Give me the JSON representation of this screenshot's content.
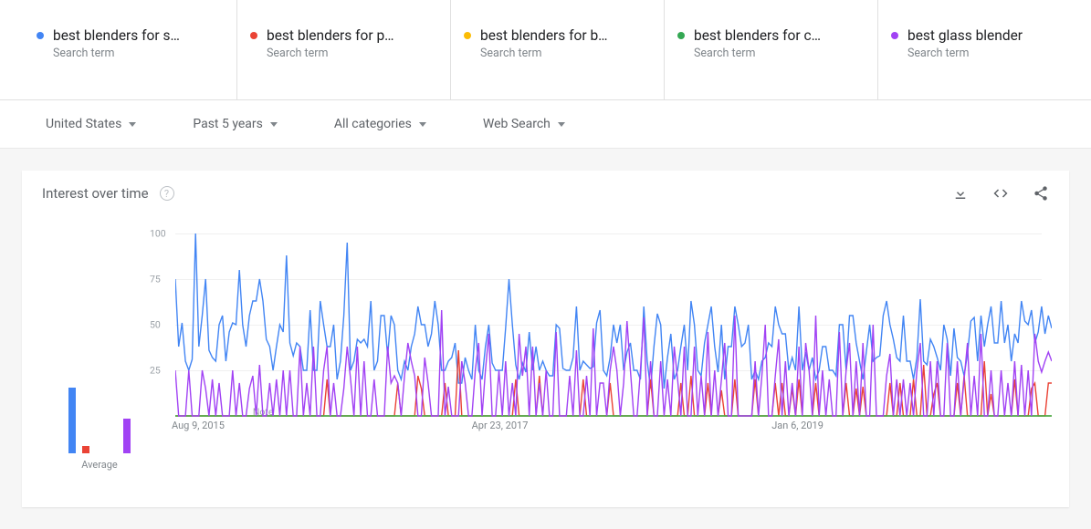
{
  "terms": [
    {
      "label": "best blenders for s…",
      "sub": "Search term",
      "color": "#4285F4"
    },
    {
      "label": "best blenders for p…",
      "sub": "Search term",
      "color": "#EA4335"
    },
    {
      "label": "best blenders for b…",
      "sub": "Search term",
      "color": "#FBBC04"
    },
    {
      "label": "best blenders for c…",
      "sub": "Search term",
      "color": "#34A853"
    },
    {
      "label": "best glass blender",
      "sub": "Search term",
      "color": "#A142F4"
    }
  ],
  "filters": {
    "region": "United States",
    "timeframe": "Past 5 years",
    "category": "All categories",
    "search_type": "Web Search"
  },
  "card": {
    "title": "Interest over time"
  },
  "chart_data": {
    "type": "line",
    "ylim": [
      0,
      100
    ],
    "yticks": [
      25,
      50,
      75,
      100
    ],
    "xticks": [
      {
        "index": 0,
        "label": "Aug 9, 2015"
      },
      {
        "index": 89,
        "label": "Apr 23, 2017"
      },
      {
        "index": 178,
        "label": "Jan 6, 2019"
      }
    ],
    "note": {
      "label": "Note",
      "index": 23
    },
    "averages": [
      38,
      4,
      0,
      0,
      20
    ],
    "avg_label": "Average",
    "n_points": 261,
    "series": [
      {
        "name": "best blenders for s…",
        "color": "#4285F4",
        "values": [
          75,
          38,
          51,
          30,
          25,
          31,
          100,
          38,
          55,
          75,
          36,
          32,
          30,
          50,
          55,
          30,
          46,
          51,
          50,
          80,
          50,
          38,
          55,
          63,
          63,
          75,
          63,
          42,
          38,
          25,
          38,
          50,
          46,
          88,
          40,
          33,
          40,
          38,
          25,
          25,
          58,
          25,
          25,
          63,
          50,
          38,
          38,
          50,
          20,
          30,
          55,
          95,
          25,
          30,
          42,
          40,
          42,
          38,
          63,
          25,
          30,
          55,
          55,
          33,
          55,
          50,
          25,
          20,
          30,
          25,
          38,
          45,
          60,
          50,
          50,
          38,
          45,
          63,
          50,
          25,
          25,
          30,
          32,
          40,
          18,
          18,
          32,
          25,
          20,
          50,
          25,
          20,
          38,
          50,
          29,
          25,
          25,
          25,
          48,
          75,
          50,
          28,
          20,
          29,
          24,
          46,
          25,
          38,
          25,
          30,
          25,
          22,
          22,
          50,
          48,
          26,
          25,
          25,
          32,
          60,
          25,
          30,
          28,
          26,
          27,
          51,
          58,
          25,
          22,
          32,
          50,
          40,
          50,
          25,
          35,
          40,
          25,
          25,
          20,
          60,
          30,
          15,
          38,
          56,
          50,
          15,
          32,
          45,
          20,
          25,
          38,
          50,
          25,
          63,
          50,
          25,
          22,
          40,
          50,
          60,
          38,
          24,
          50,
          20,
          38,
          38,
          60,
          50,
          38,
          40,
          50,
          20,
          25,
          20,
          30,
          32,
          40,
          38,
          60,
          50,
          45,
          45,
          25,
          32,
          25,
          60,
          25,
          35,
          25,
          32,
          20,
          25,
          38,
          38,
          25,
          25,
          22,
          50,
          50,
          25,
          55,
          55,
          40,
          30,
          20,
          35,
          50,
          30,
          32,
          33,
          55,
          63,
          50,
          42,
          32,
          30,
          55,
          30,
          30,
          20,
          32,
          64,
          30,
          28,
          42,
          38,
          32,
          25,
          50,
          42,
          22,
          48,
          32,
          30,
          22,
          34,
          52,
          54,
          30,
          55,
          38,
          50,
          60,
          40,
          40,
          63,
          40,
          50,
          30,
          45,
          40,
          63,
          52,
          50,
          58,
          40,
          46,
          60,
          45,
          55,
          48
        ]
      },
      {
        "name": "best blenders for p…",
        "color": "#EA4335",
        "values": [
          0,
          0,
          0,
          0,
          0,
          0,
          0,
          0,
          0,
          0,
          0,
          0,
          0,
          0,
          0,
          0,
          0,
          0,
          0,
          0,
          0,
          0,
          0,
          0,
          0,
          0,
          0,
          0,
          0,
          0,
          0,
          0,
          0,
          0,
          0,
          0,
          0,
          0,
          0,
          0,
          0,
          0,
          0,
          0,
          0,
          20,
          0,
          0,
          0,
          0,
          0,
          0,
          0,
          0,
          0,
          0,
          0,
          0,
          0,
          0,
          0,
          0,
          0,
          0,
          0,
          0,
          18,
          0,
          0,
          0,
          0,
          0,
          22,
          15,
          0,
          0,
          0,
          0,
          0,
          0,
          18,
          0,
          0,
          0,
          36,
          0,
          0,
          0,
          0,
          0,
          0,
          0,
          0,
          0,
          0,
          0,
          0,
          0,
          0,
          0,
          0,
          20,
          0,
          0,
          0,
          0,
          0,
          0,
          22,
          0,
          0,
          0,
          0,
          0,
          0,
          0,
          0,
          0,
          0,
          0,
          0,
          20,
          0,
          0,
          0,
          0,
          0,
          0,
          0,
          18,
          0,
          0,
          0,
          0,
          0,
          0,
          0,
          0,
          0,
          0,
          0,
          20,
          0,
          0,
          0,
          0,
          0,
          0,
          0,
          0,
          18,
          0,
          0,
          22,
          0,
          0,
          0,
          0,
          18,
          0,
          0,
          0,
          14,
          0,
          0,
          0,
          20,
          0,
          0,
          0,
          0,
          0,
          20,
          0,
          0,
          0,
          0,
          0,
          18,
          0,
          18,
          0,
          0,
          15,
          0,
          20,
          0,
          0,
          0,
          0,
          18,
          0,
          0,
          0,
          0,
          0,
          0,
          0,
          0,
          18,
          0,
          0,
          15,
          0,
          16,
          0,
          0,
          0,
          0,
          0,
          0,
          0,
          18,
          0,
          0,
          18,
          0,
          0,
          0,
          20,
          0,
          0,
          28,
          0,
          0,
          12,
          18,
          0,
          0,
          0,
          0,
          0,
          18,
          0,
          22,
          0,
          0,
          0,
          0,
          0,
          30,
          0,
          12,
          0,
          0,
          0,
          0,
          0,
          0,
          20,
          0,
          0,
          0,
          0,
          15,
          18,
          0,
          0,
          0,
          18,
          18
        ]
      },
      {
        "name": "best blenders for b…",
        "color": "#FBBC04",
        "values": [
          0,
          0,
          0,
          0,
          0,
          0,
          0,
          0,
          0,
          0,
          0,
          0,
          0,
          0,
          0,
          0,
          0,
          0,
          0,
          0,
          0,
          0,
          0,
          0,
          0,
          0,
          0,
          0,
          0,
          0,
          0,
          0,
          0,
          0,
          0,
          0,
          0,
          0,
          0,
          0,
          0,
          0,
          0,
          0,
          0,
          0,
          0,
          0,
          0,
          0,
          0,
          0,
          0,
          0,
          0,
          0,
          0,
          0,
          0,
          0,
          0,
          0,
          0,
          0,
          0,
          0,
          0,
          0,
          0,
          0,
          0,
          0,
          0,
          0,
          0,
          0,
          0,
          0,
          0,
          0,
          0,
          0,
          0,
          0,
          0,
          0,
          0,
          0,
          0,
          0,
          0,
          0,
          0,
          0,
          0,
          0,
          0,
          0,
          0,
          0,
          0,
          0,
          0,
          0,
          0,
          0,
          0,
          0,
          0,
          0,
          0,
          0,
          0,
          0,
          0,
          0,
          0,
          0,
          0,
          0,
          0,
          0,
          0,
          0,
          0,
          0,
          0,
          0,
          0,
          0,
          0,
          0,
          0,
          0,
          0,
          0,
          0,
          0,
          0,
          0,
          0,
          0,
          0,
          0,
          0,
          0,
          0,
          0,
          0,
          0,
          0,
          0,
          0,
          0,
          0,
          0,
          0,
          0,
          0,
          0,
          0,
          0,
          0,
          0,
          0,
          0,
          0,
          0,
          0,
          0,
          0,
          0,
          0,
          0,
          0,
          0,
          0,
          0,
          0,
          0,
          0,
          0,
          0,
          0,
          0,
          0,
          0,
          0,
          0,
          0,
          0,
          0,
          0,
          0,
          0,
          0,
          0,
          0,
          0,
          0,
          0,
          0,
          0,
          0,
          0,
          0,
          0,
          0,
          0,
          0,
          0,
          0,
          0,
          0,
          0,
          0,
          0,
          0,
          0,
          0,
          0,
          0,
          0,
          0,
          0,
          0,
          0,
          0,
          0,
          0,
          0,
          0,
          0,
          0,
          0,
          0,
          0,
          0,
          0,
          0,
          0,
          0,
          0,
          0,
          0,
          0,
          0,
          0,
          0,
          0,
          0,
          0,
          0,
          0,
          0,
          0,
          0,
          0,
          0,
          0,
          0
        ]
      },
      {
        "name": "best blenders for c…",
        "color": "#34A853",
        "values": [
          0,
          0,
          0,
          0,
          0,
          0,
          0,
          0,
          0,
          0,
          0,
          0,
          0,
          0,
          0,
          0,
          0,
          0,
          0,
          0,
          0,
          0,
          0,
          0,
          0,
          0,
          0,
          0,
          0,
          0,
          0,
          0,
          0,
          0,
          0,
          0,
          0,
          0,
          0,
          0,
          0,
          0,
          0,
          0,
          0,
          0,
          0,
          0,
          0,
          0,
          0,
          0,
          0,
          0,
          0,
          0,
          0,
          0,
          0,
          0,
          0,
          0,
          0,
          0,
          0,
          0,
          0,
          0,
          0,
          0,
          0,
          0,
          0,
          0,
          0,
          0,
          0,
          0,
          0,
          0,
          0,
          0,
          0,
          0,
          0,
          0,
          0,
          0,
          0,
          0,
          0,
          0,
          0,
          0,
          0,
          0,
          0,
          0,
          0,
          0,
          0,
          0,
          0,
          0,
          0,
          0,
          0,
          0,
          0,
          0,
          0,
          0,
          0,
          0,
          0,
          0,
          0,
          0,
          0,
          0,
          0,
          0,
          0,
          0,
          0,
          0,
          0,
          0,
          0,
          0,
          0,
          0,
          0,
          0,
          0,
          0,
          0,
          0,
          0,
          0,
          0,
          0,
          0,
          0,
          0,
          0,
          0,
          0,
          0,
          0,
          0,
          0,
          0,
          0,
          0,
          0,
          0,
          0,
          0,
          0,
          0,
          0,
          0,
          0,
          0,
          0,
          0,
          0,
          0,
          0,
          0,
          0,
          0,
          0,
          0,
          0,
          0,
          0,
          0,
          0,
          0,
          0,
          0,
          0,
          0,
          0,
          0,
          0,
          0,
          0,
          0,
          0,
          0,
          0,
          0,
          0,
          0,
          0,
          0,
          0,
          0,
          0,
          0,
          0,
          0,
          0,
          0,
          0,
          0,
          0,
          0,
          0,
          0,
          0,
          0,
          0,
          0,
          0,
          0,
          0,
          0,
          0,
          0,
          0,
          0,
          0,
          0,
          0,
          0,
          0,
          0,
          0,
          0,
          0,
          0,
          0,
          0,
          0,
          0,
          0,
          0,
          0,
          0,
          0,
          0,
          0,
          0,
          0,
          0,
          0,
          0,
          0,
          0,
          0,
          0,
          0,
          0,
          0,
          0,
          0,
          0
        ]
      },
      {
        "name": "best glass blender",
        "color": "#A142F4",
        "values": [
          25,
          0,
          0,
          0,
          25,
          0,
          0,
          0,
          25,
          15,
          0,
          20,
          0,
          18,
          0,
          0,
          0,
          25,
          0,
          18,
          0,
          0,
          15,
          22,
          0,
          28,
          0,
          0,
          18,
          0,
          20,
          0,
          25,
          0,
          25,
          0,
          0,
          38,
          0,
          18,
          0,
          38,
          0,
          0,
          25,
          38,
          0,
          18,
          0,
          0,
          15,
          38,
          20,
          0,
          38,
          0,
          30,
          0,
          0,
          20,
          0,
          0,
          0,
          38,
          18,
          22,
          18,
          0,
          22,
          40,
          30,
          22,
          0,
          0,
          32,
          18,
          0,
          0,
          0,
          58,
          0,
          16,
          0,
          0,
          0,
          30,
          18,
          0,
          0,
          25,
          40,
          0,
          25,
          45,
          0,
          0,
          25,
          0,
          30,
          0,
          18,
          0,
          45,
          22,
          38,
          0,
          38,
          0,
          18,
          0,
          25,
          0,
          0,
          46,
          0,
          0,
          0,
          22,
          0,
          36,
          0,
          0,
          22,
          0,
          48,
          0,
          18,
          18,
          0,
          25,
          38,
          25,
          0,
          18,
          52,
          25,
          0,
          0,
          25,
          54,
          0,
          30,
          0,
          0,
          30,
          0,
          20,
          0,
          38,
          20,
          0,
          38,
          0,
          0,
          38,
          0,
          22,
          0,
          46,
          0,
          25,
          0,
          20,
          40,
          0,
          0,
          55,
          0,
          0,
          0,
          0,
          0,
          30,
          0,
          22,
          50,
          0,
          0,
          22,
          42,
          0,
          30,
          0,
          18,
          0,
          38,
          0,
          40,
          25,
          0,
          55,
          0,
          25,
          0,
          20,
          0,
          0,
          46,
          0,
          25,
          40,
          0,
          30,
          0,
          40,
          0,
          0,
          50,
          0,
          0,
          0,
          22,
          34,
          0,
          20,
          0,
          20,
          0,
          18,
          0,
          25,
          40,
          0,
          0,
          30,
          0,
          30,
          0,
          0,
          40,
          0,
          0,
          30,
          0,
          20,
          40,
          0,
          22,
          0,
          45,
          0,
          0,
          25,
          0,
          0,
          25,
          0,
          18,
          0,
          30,
          0,
          28,
          0,
          25,
          0,
          45,
          30,
          24,
          30,
          35,
          30
        ]
      }
    ]
  }
}
